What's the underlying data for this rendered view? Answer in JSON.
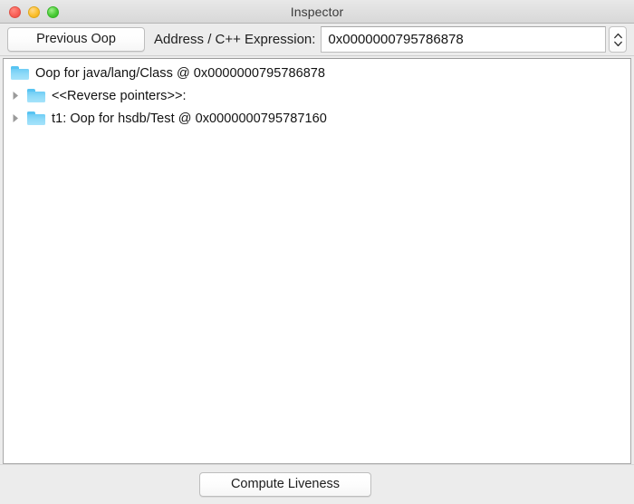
{
  "window": {
    "title": "Inspector",
    "controls": [
      {
        "name": "close",
        "color": "#fa6158"
      },
      {
        "name": "minimize",
        "color": "#fcc02e"
      },
      {
        "name": "maximize",
        "color": "#4ccc38"
      }
    ]
  },
  "toolbar": {
    "previous_oop_label": "Previous Oop",
    "address_label": "Address / C++ Expression:",
    "address_value": "0x0000000795786878",
    "address_placeholder": "",
    "stepper_icon": "stepper-up-down-icon"
  },
  "tree": {
    "rows": [
      {
        "label": "Oop for java/lang/Class @ 0x0000000795786878",
        "depth": 0,
        "has_twisty": false,
        "expanded": true,
        "icon": "folder-icon"
      },
      {
        "label": "<<Reverse pointers>>:",
        "depth": 1,
        "has_twisty": true,
        "expanded": false,
        "icon": "folder-icon"
      },
      {
        "label": "t1: Oop for hsdb/Test @ 0x0000000795787160",
        "depth": 1,
        "has_twisty": true,
        "expanded": false,
        "icon": "folder-icon"
      }
    ]
  },
  "footer": {
    "compute_liveness_label": "Compute Liveness"
  },
  "colors": {
    "folder_blue": "#8edaf8",
    "titlebar": "#e0e0e0",
    "toolbar": "#ececec",
    "content_background": "#ffffff"
  }
}
